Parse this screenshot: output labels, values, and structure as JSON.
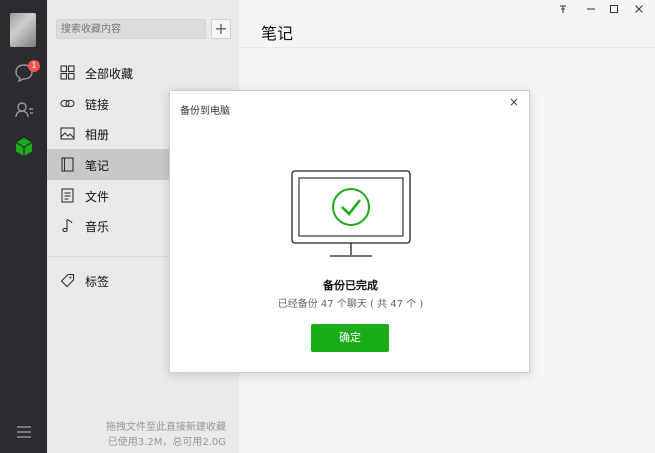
{
  "rail": {
    "unread_count": "1",
    "colors": {
      "accent": "#1aad19",
      "badge": "#fa5151"
    },
    "icons": [
      "avatar",
      "chat-icon",
      "contacts-icon",
      "favorites-icon",
      "menu-icon"
    ]
  },
  "panel": {
    "search_placeholder": "搜索收藏内容",
    "add_label": "+",
    "items": [
      {
        "label": "全部收藏",
        "icon": "grid-icon"
      },
      {
        "label": "链接",
        "icon": "link-icon"
      },
      {
        "label": "相册",
        "icon": "image-icon"
      },
      {
        "label": "笔记",
        "icon": "note-icon",
        "active": true
      },
      {
        "label": "文件",
        "icon": "file-icon"
      },
      {
        "label": "音乐",
        "icon": "music-icon"
      },
      {
        "label": "标签",
        "icon": "tag-icon"
      }
    ],
    "footer_line1": "拖拽文件至此直接新建收藏",
    "footer_line2": "已使用3.2M，总可用2.0G"
  },
  "main": {
    "title": "笔记",
    "window_controls": [
      "pin-icon",
      "minimize-icon",
      "maximize-icon",
      "close-icon"
    ]
  },
  "modal": {
    "title": "备份到电脑",
    "close": "×",
    "status_title": "备份已完成",
    "status_detail": "已经备份 47 个聊天 ( 共 47 个 )",
    "ok_label": "确定"
  }
}
